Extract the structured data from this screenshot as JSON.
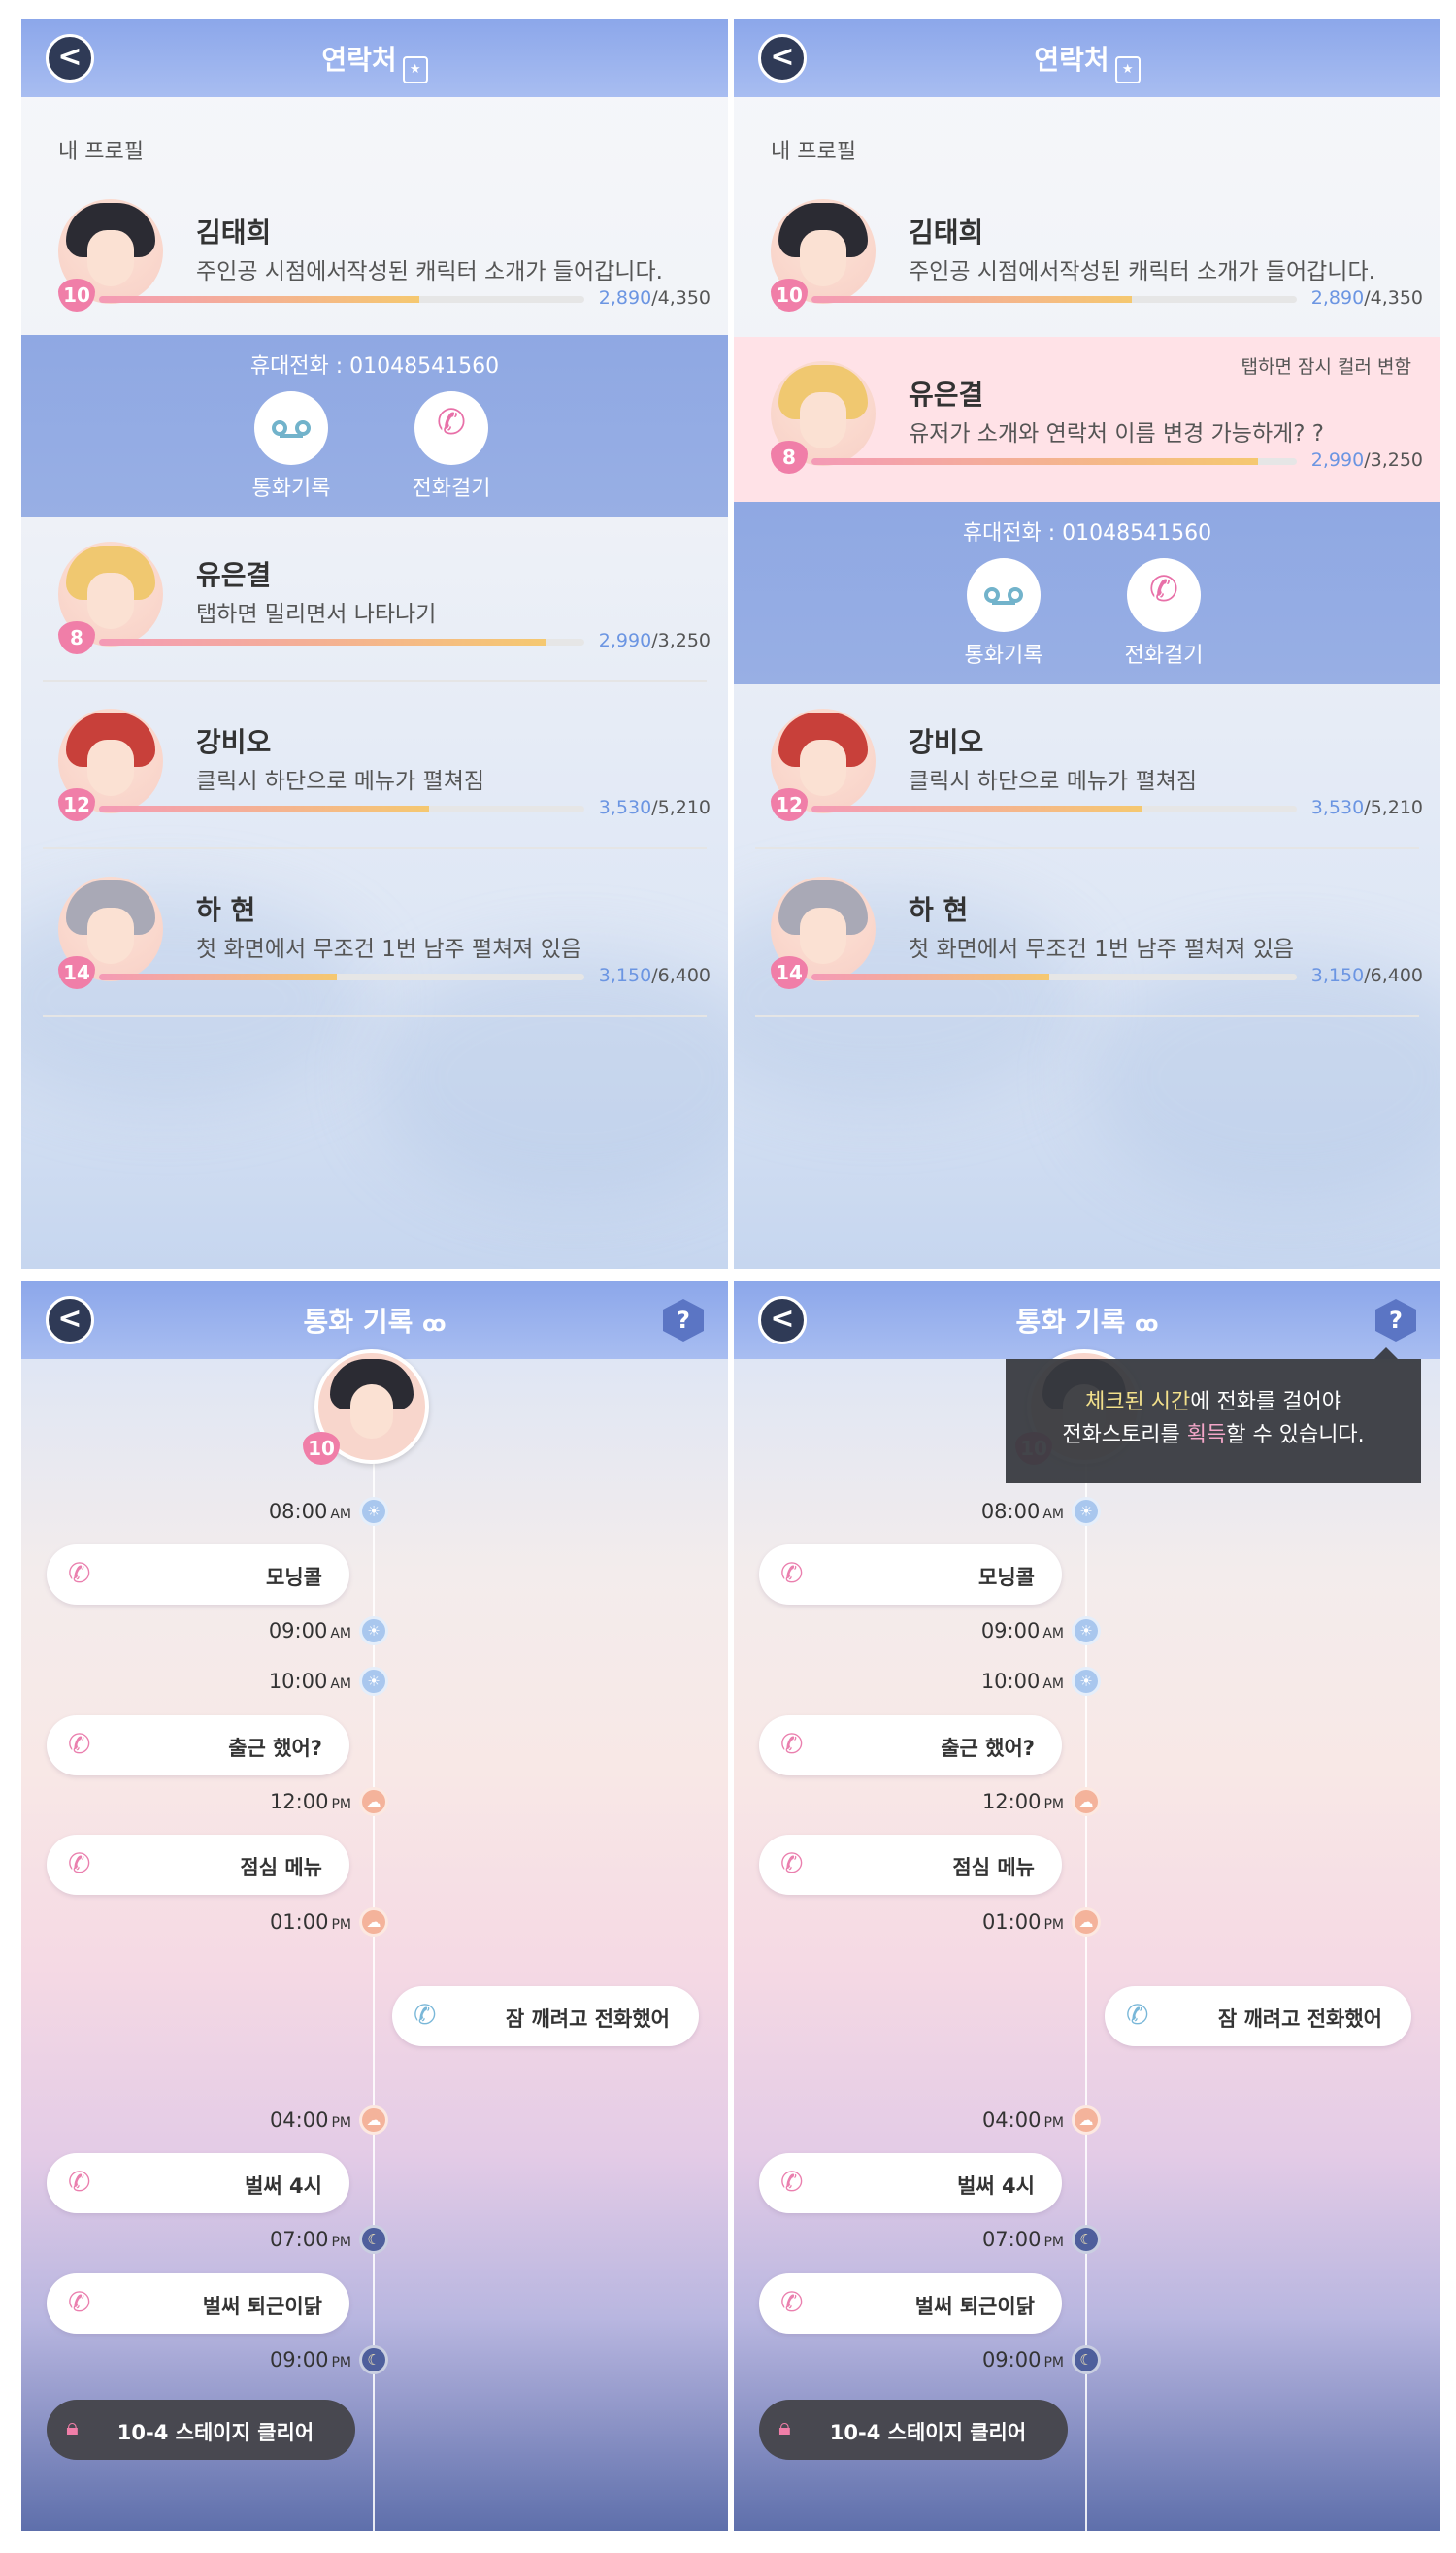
{
  "contacts": {
    "title": "연락처",
    "back": "<",
    "book_icon": "★",
    "section": "내 프로필",
    "profile": {
      "name": "김태희",
      "desc": "주인공 시점에서작성된 캐릭터 소개가 들어갑니다.",
      "level": "10",
      "cur": "2,890",
      "max": "/4,350",
      "fill": 0.66
    },
    "phone": "휴대전화 : 01048541560",
    "call_log_label": "통화기록",
    "call_label": "전화걸기",
    "tap_hint": "탭하면 잠시 컬러 변함",
    "yu1": {
      "name": "유은결",
      "desc": "탭하면 밀리면서 나타나기",
      "level": "8",
      "cur": "2,990",
      "max": "/3,250",
      "fill": 0.92
    },
    "yu2": {
      "name": "유은결",
      "desc": "유저가 소개와 연락처 이름 변경 가능하게? ?",
      "level": "8",
      "cur": "2,990",
      "max": "/3,250",
      "fill": 0.92
    },
    "kang": {
      "name": "강비오",
      "desc": "클릭시 하단으로 메뉴가 펼쳐짐",
      "level": "12",
      "cur": "3,530",
      "max": "/5,210",
      "fill": 0.68
    },
    "ha": {
      "name": "하 현",
      "desc": "첫 화면에서 무조건 1번 남주 펼쳐져 있음",
      "level": "14",
      "cur": "3,150",
      "max": "/6,400",
      "fill": 0.49
    }
  },
  "calllog": {
    "title": "통화 기록",
    "help": "?",
    "level": "10",
    "t0800": "08:00",
    "t0900": "09:00",
    "t1000": "10:00",
    "t1200": "12:00",
    "t0100": "01:00",
    "t0400": "04:00",
    "t0700": "07:00",
    "t0900b": "09:00",
    "am": "AM",
    "pm": "PM",
    "c1": "모닝콜",
    "c2": "출근 했어?",
    "c3": "점심 메뉴",
    "c4": "잠 깨려고 전화했어",
    "c5": "벌써 4시",
    "c6": "벌써 퇴근이닭",
    "lock": "10-4 스테이지 클리어",
    "tip_a": "체크된 시간",
    "tip_b": "에 전화를 걸어야",
    "tip_c": "전화스토리를 ",
    "tip_d": "획득",
    "tip_e": "할 수 있습니다."
  },
  "colors": {
    "header": "#8ca7ea",
    "panel": "#98afe4",
    "pink": "#f07ea8",
    "highlight": "#ffe0e6",
    "points": "#6b95e2"
  }
}
